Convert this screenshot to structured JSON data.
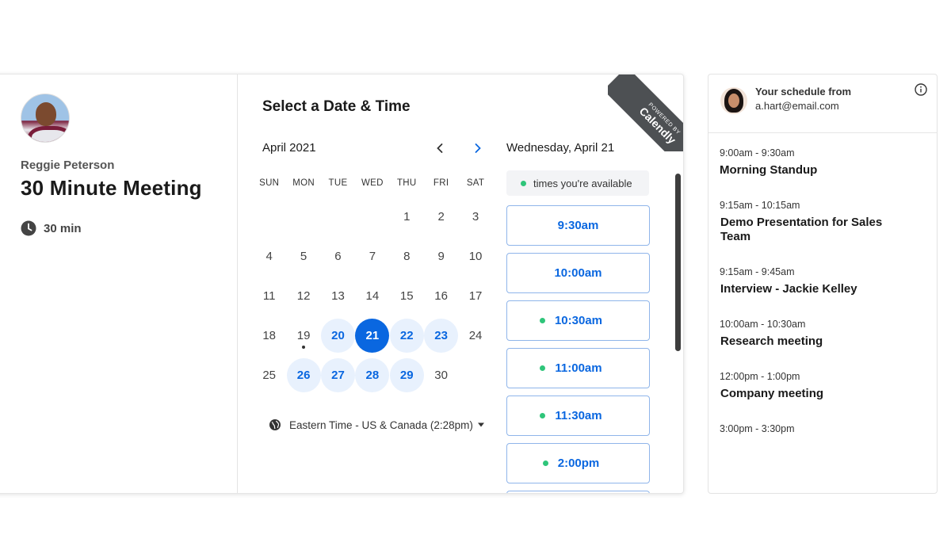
{
  "booking": {
    "host_name": "Reggie Peterson",
    "event_title": "30 Minute Meeting",
    "duration": "30 min",
    "calendar_title": "Select a Date & Time",
    "month": "April 2021",
    "weekdays": [
      "SUN",
      "MON",
      "TUE",
      "WED",
      "THU",
      "FRI",
      "SAT"
    ],
    "days": [
      {
        "label": "",
        "state": "empty"
      },
      {
        "label": "",
        "state": "empty"
      },
      {
        "label": "",
        "state": "empty"
      },
      {
        "label": "",
        "state": "empty"
      },
      {
        "label": "1",
        "state": "plain"
      },
      {
        "label": "2",
        "state": "plain"
      },
      {
        "label": "3",
        "state": "plain"
      },
      {
        "label": "4",
        "state": "plain"
      },
      {
        "label": "5",
        "state": "plain"
      },
      {
        "label": "6",
        "state": "plain"
      },
      {
        "label": "7",
        "state": "plain"
      },
      {
        "label": "8",
        "state": "plain"
      },
      {
        "label": "9",
        "state": "plain"
      },
      {
        "label": "10",
        "state": "plain"
      },
      {
        "label": "11",
        "state": "plain"
      },
      {
        "label": "12",
        "state": "plain"
      },
      {
        "label": "13",
        "state": "plain"
      },
      {
        "label": "14",
        "state": "plain"
      },
      {
        "label": "15",
        "state": "plain"
      },
      {
        "label": "16",
        "state": "plain"
      },
      {
        "label": "17",
        "state": "plain"
      },
      {
        "label": "18",
        "state": "plain"
      },
      {
        "label": "19",
        "state": "today"
      },
      {
        "label": "20",
        "state": "available"
      },
      {
        "label": "21",
        "state": "selected"
      },
      {
        "label": "22",
        "state": "available"
      },
      {
        "label": "23",
        "state": "available"
      },
      {
        "label": "24",
        "state": "plain"
      },
      {
        "label": "25",
        "state": "plain"
      },
      {
        "label": "26",
        "state": "available"
      },
      {
        "label": "27",
        "state": "available"
      },
      {
        "label": "28",
        "state": "available"
      },
      {
        "label": "29",
        "state": "available"
      },
      {
        "label": "30",
        "state": "plain"
      }
    ],
    "timezone": "Eastern Time - US & Canada (2:28pm)",
    "selected_date": "Wednesday, April 21",
    "legend": "times you're available",
    "slots": [
      {
        "label": "9:30am",
        "available_dot": false
      },
      {
        "label": "10:00am",
        "available_dot": false
      },
      {
        "label": "10:30am",
        "available_dot": true
      },
      {
        "label": "11:00am",
        "available_dot": true
      },
      {
        "label": "11:30am",
        "available_dot": true
      },
      {
        "label": "2:00pm",
        "available_dot": true
      },
      {
        "label": "",
        "available_dot": false
      }
    ],
    "ribbon": {
      "small": "POWERED BY",
      "brand": "Calendly"
    },
    "colors": {
      "accent": "#0a67e0",
      "available_dot": "#2fc57a",
      "ribbon": "#4d5053"
    }
  },
  "schedule": {
    "heading": "Your schedule from",
    "email": "a.hart@email.com",
    "events": [
      {
        "time": "9:00am - 9:30am",
        "name": "Morning Standup"
      },
      {
        "time": "9:15am - 10:15am",
        "name": "Demo Presentation for Sales Team"
      },
      {
        "time": "9:15am - 9:45am",
        "name": "Interview - Jackie Kelley"
      },
      {
        "time": "10:00am - 10:30am",
        "name": "Research meeting"
      },
      {
        "time": "12:00pm - 1:00pm",
        "name": "Company meeting"
      },
      {
        "time": "3:00pm - 3:30pm",
        "name": ""
      }
    ]
  }
}
